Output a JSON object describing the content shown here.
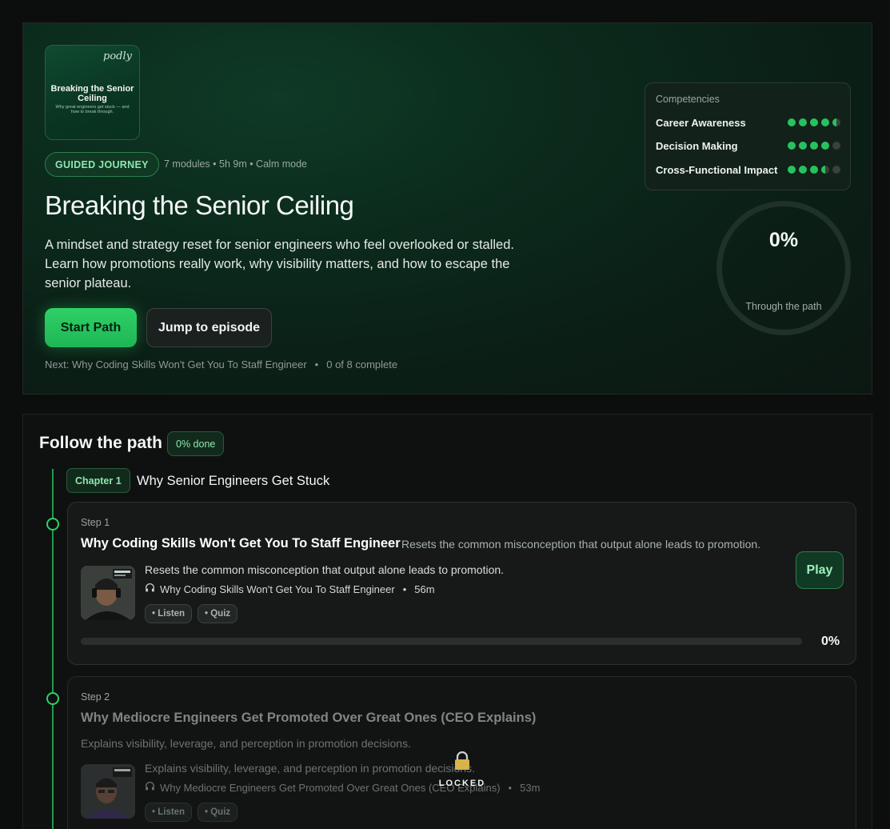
{
  "hero": {
    "cover": {
      "brand": "podly",
      "title": "Breaking the Senior Ceiling",
      "subtitle": "Why great engineers get stuck — and how to break through."
    },
    "badge": "GUIDED JOURNEY",
    "meta": "7 modules • 5h 9m • Calm mode",
    "title": "Breaking the Senior Ceiling",
    "description": "A mindset and strategy reset for senior engineers who feel overlooked or stalled. Learn how promotions really work, why visibility matters, and how to escape the senior plateau.",
    "start_label": "Start Path",
    "jump_label": "Jump to episode",
    "next_text": "Next: Why Coding Skills Won't Get You To Staff Engineer",
    "next_sep": "•",
    "complete_text": "0 of 8 complete",
    "competencies": {
      "header": "Competencies",
      "items": [
        {
          "label": "Career Awareness",
          "level": 4.5
        },
        {
          "label": "Decision Making",
          "level": 4
        },
        {
          "label": "Cross-Functional Impact",
          "level": 3.5
        }
      ]
    },
    "progress": {
      "value": "0%",
      "label": "Through the path"
    }
  },
  "path": {
    "title": "Follow the path",
    "done_badge": "0% done",
    "chapter": {
      "badge": "Chapter 1",
      "title": "Why Senior Engineers Get Stuck"
    },
    "steps": [
      {
        "label": "Step 1",
        "title": "Why Coding Skills Won't Get You To Staff Engineer",
        "summary": "Resets the common misconception that output alone leads to promotion.",
        "episode_desc": "Resets the common misconception that output alone leads to promotion.",
        "episode_title": "Why Coding Skills Won't Get You To Staff Engineer",
        "duration": "56m",
        "chips": [
          "• Listen",
          "• Quiz"
        ],
        "play_label": "Play",
        "progress": "0%",
        "progress_fraction": 0
      },
      {
        "label": "Step 2",
        "title": "Why Mediocre Engineers Get Promoted Over Great Ones (CEO Explains)",
        "summary": "Explains visibility, leverage, and perception in promotion decisions.",
        "episode_desc": "Explains visibility, leverage, and perception in promotion decisions.",
        "episode_title": "Why Mediocre Engineers Get Promoted Over Great Ones (CEO Explains)",
        "duration": "53m",
        "chips": [
          "• Listen",
          "• Quiz"
        ],
        "locked_label": "LOCKED"
      }
    ]
  },
  "colors": {
    "accent": "#2ed166",
    "background": "#0c0d0d",
    "hero_bg": "#0b2a1c"
  },
  "icons": {
    "headphones": "headphones-icon",
    "lock": "lock-icon"
  }
}
